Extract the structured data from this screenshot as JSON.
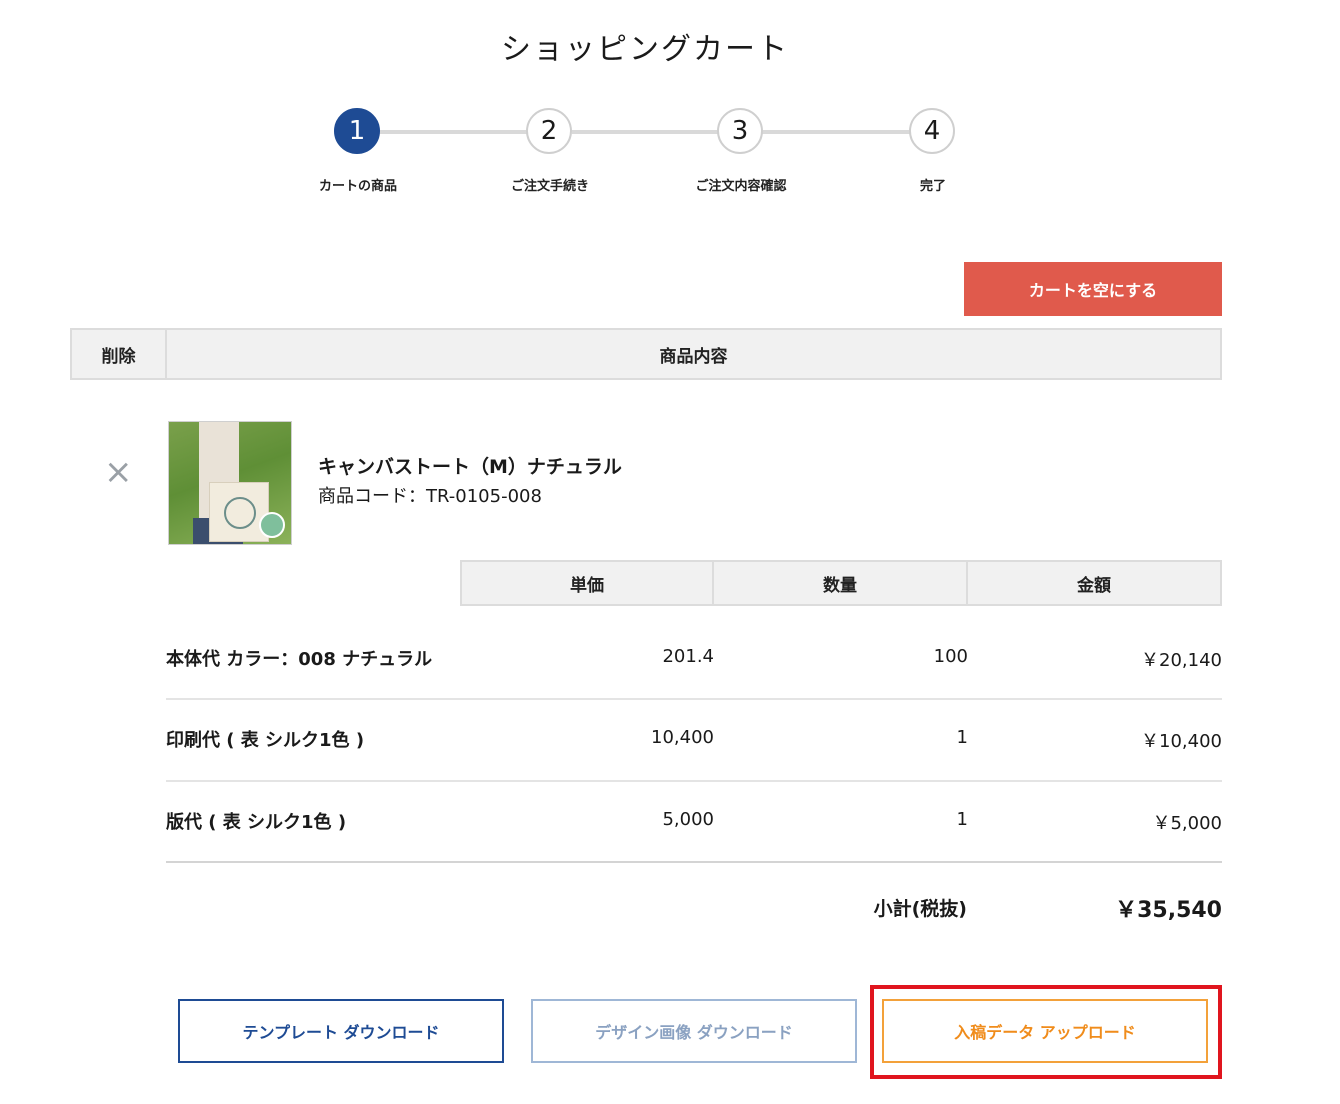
{
  "page": {
    "title": "ショッピングカート"
  },
  "steps": [
    {
      "number": "1",
      "label": "カートの商品",
      "active": true
    },
    {
      "number": "2",
      "label": "ご注文手続き",
      "active": false
    },
    {
      "number": "3",
      "label": "ご注文内容確認",
      "active": false
    },
    {
      "number": "4",
      "label": "完了",
      "active": false
    }
  ],
  "actions": {
    "empty_cart": "カートを空にする"
  },
  "table_header": {
    "delete": "削除",
    "content": "商品内容"
  },
  "product": {
    "name": "キャンバストート（M）ナチュラル",
    "code": "商品コード：TR-0105-008",
    "remove_icon": "close-icon"
  },
  "line_header": {
    "unit_price": "単価",
    "quantity": "数量",
    "amount": "金額"
  },
  "lines": [
    {
      "label": "本体代 カラー：008 ナチュラル",
      "unit_price": "201.4",
      "quantity": "100",
      "amount": "￥20,140"
    },
    {
      "label": "印刷代 ( 表 シルク1色 )",
      "unit_price": "10,400",
      "quantity": "1",
      "amount": "￥10,400"
    },
    {
      "label": "版代 ( 表 シルク1色 )",
      "unit_price": "5,000",
      "quantity": "1",
      "amount": "￥5,000"
    }
  ],
  "subtotal": {
    "label": "小計(税抜)",
    "value": "￥35,540"
  },
  "buttons": {
    "template_download": "テンプレート ダウンロード",
    "design_download": "デザイン画像 ダウンロード",
    "upload": "入稿データ アップロード"
  },
  "colors": {
    "step_active": "#1e4b94",
    "empty_cart_bg": "#e05a4c",
    "upload_accent": "#f08c1b",
    "highlight": "#e0151e"
  }
}
